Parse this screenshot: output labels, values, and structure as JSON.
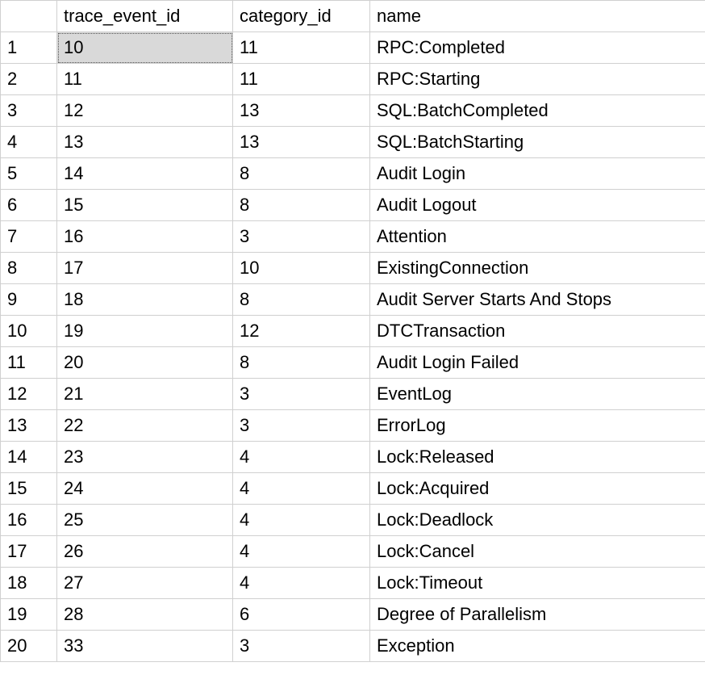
{
  "columns": [
    "trace_event_id",
    "category_id",
    "name"
  ],
  "selected_cell": {
    "row": 0,
    "col": 0
  },
  "rows": [
    {
      "n": "1",
      "trace_event_id": "10",
      "category_id": "11",
      "name": "RPC:Completed"
    },
    {
      "n": "2",
      "trace_event_id": "11",
      "category_id": "11",
      "name": "RPC:Starting"
    },
    {
      "n": "3",
      "trace_event_id": "12",
      "category_id": "13",
      "name": "SQL:BatchCompleted"
    },
    {
      "n": "4",
      "trace_event_id": "13",
      "category_id": "13",
      "name": "SQL:BatchStarting"
    },
    {
      "n": "5",
      "trace_event_id": "14",
      "category_id": "8",
      "name": "Audit Login"
    },
    {
      "n": "6",
      "trace_event_id": "15",
      "category_id": "8",
      "name": "Audit Logout"
    },
    {
      "n": "7",
      "trace_event_id": "16",
      "category_id": "3",
      "name": "Attention"
    },
    {
      "n": "8",
      "trace_event_id": "17",
      "category_id": "10",
      "name": "ExistingConnection"
    },
    {
      "n": "9",
      "trace_event_id": "18",
      "category_id": "8",
      "name": "Audit Server Starts And Stops"
    },
    {
      "n": "10",
      "trace_event_id": "19",
      "category_id": "12",
      "name": "DTCTransaction"
    },
    {
      "n": "11",
      "trace_event_id": "20",
      "category_id": "8",
      "name": "Audit Login Failed"
    },
    {
      "n": "12",
      "trace_event_id": "21",
      "category_id": "3",
      "name": "EventLog"
    },
    {
      "n": "13",
      "trace_event_id": "22",
      "category_id": "3",
      "name": "ErrorLog"
    },
    {
      "n": "14",
      "trace_event_id": "23",
      "category_id": "4",
      "name": "Lock:Released"
    },
    {
      "n": "15",
      "trace_event_id": "24",
      "category_id": "4",
      "name": "Lock:Acquired"
    },
    {
      "n": "16",
      "trace_event_id": "25",
      "category_id": "4",
      "name": "Lock:Deadlock"
    },
    {
      "n": "17",
      "trace_event_id": "26",
      "category_id": "4",
      "name": "Lock:Cancel"
    },
    {
      "n": "18",
      "trace_event_id": "27",
      "category_id": "4",
      "name": "Lock:Timeout"
    },
    {
      "n": "19",
      "trace_event_id": "28",
      "category_id": "6",
      "name": "Degree of Parallelism"
    },
    {
      "n": "20",
      "trace_event_id": "33",
      "category_id": "3",
      "name": "Exception"
    }
  ]
}
